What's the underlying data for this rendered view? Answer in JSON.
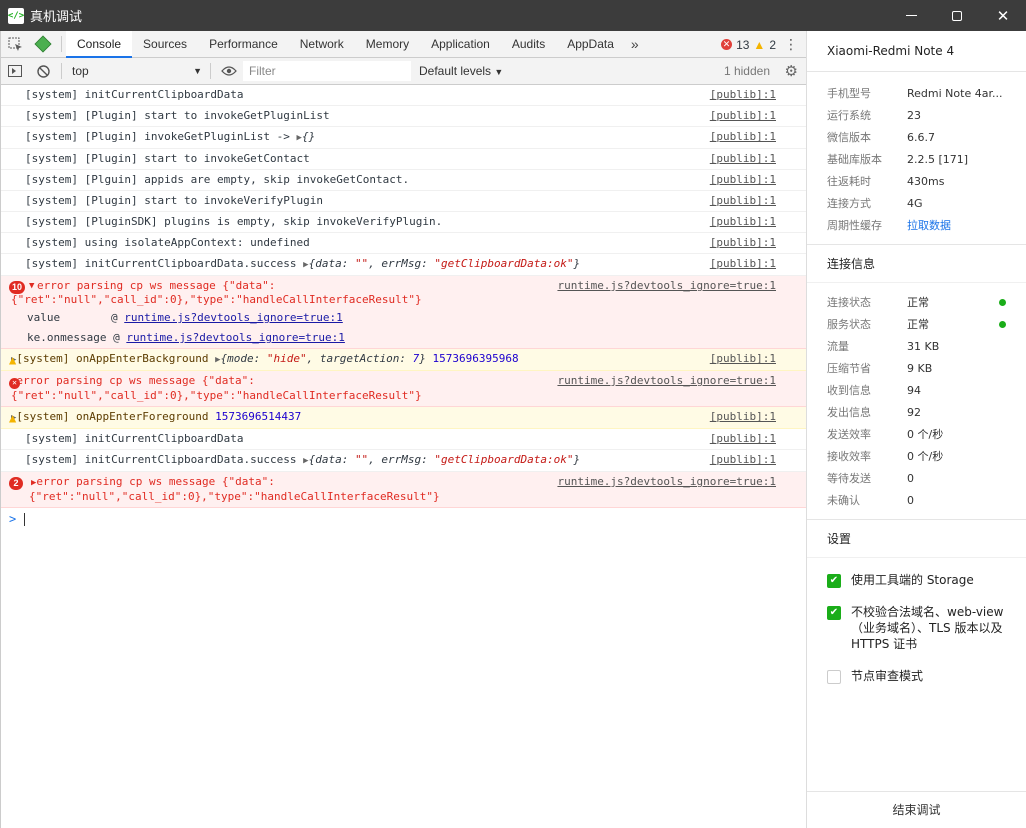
{
  "window": {
    "title": "真机调试",
    "app_icon": "</>"
  },
  "tabs": [
    "Console",
    "Sources",
    "Performance",
    "Network",
    "Memory",
    "Application",
    "Audits",
    "AppData"
  ],
  "counts": {
    "errors": "13",
    "warnings": "2"
  },
  "filterbar": {
    "context": "top",
    "filter_placeholder": "Filter",
    "levels": "Default levels",
    "hidden": "1 hidden"
  },
  "console": {
    "r1": "[system] initCurrentClipboardData",
    "r2": "[system] [Plugin] start to invokeGetPluginList",
    "r3": "[system] [Plugin] invokeGetPluginList ->",
    "r3_obj": "{}",
    "r4": "[system] [Plugin] start to invokeGetContact",
    "r5": "[system] [Plguin] appids are empty, skip invokeGetContact.",
    "r6": "[system] [Plugin] start to invokeVerifyPlugin",
    "r7": "[system] [PluginSDK] plugins is empty, skip invokeVerifyPlugin.",
    "r8": "[system] using isolateAppContext: undefined",
    "r9": "[system] initCurrentClipboardData.success",
    "r9_obj_a": "{data: ",
    "r9_obj_b": "\"\"",
    "r9_obj_c": ", errMsg: ",
    "r9_obj_d": "\"getClipboardData:ok\"",
    "r9_obj_e": "}",
    "e1_badge": "10",
    "e1_line1": "error parsing cp ws message {\"data\":",
    "e1_line2": "{\"ret\":\"null\",\"call_id\":0},\"type\":\"handleCallInterfaceResult\"}",
    "e1_stack1_fn": "value",
    "e1_stack1_at": "@",
    "e1_stack2_fn": "ke.onmessage",
    "e1_stack2_at": "@",
    "runtime_link": "runtime.js?devtools_ignore=true:1",
    "w1": "[system] onAppEnterBackground",
    "w1_obj_a": "{mode: ",
    "w1_obj_b": "\"hide\"",
    "w1_obj_c": ", targetAction: ",
    "w1_obj_d": "7",
    "w1_obj_e": "}",
    "w1_num": "1573696395968",
    "e2_line1": "error parsing cp ws message {\"data\":",
    "e2_line2": "{\"ret\":\"null\",\"call_id\":0},\"type\":\"handleCallInterfaceResult\"}",
    "w2": "[system] onAppEnterForeground",
    "w2_num": "1573696514437",
    "r10": "[system] initCurrentClipboardData",
    "r11": "[system] initCurrentClipboardData.success",
    "e3_badge": "2",
    "e3_line1": "error parsing cp ws message {\"data\":",
    "e3_line2": "{\"ret\":\"null\",\"call_id\":0},\"type\":\"handleCallInterfaceResult\"}",
    "publib": "[publib]:1",
    "prompt": ">"
  },
  "device": {
    "name": "Xiaomi-Redmi Note 4",
    "info": [
      {
        "k": "手机型号",
        "v": "Redmi Note 4ar..."
      },
      {
        "k": "运行系统",
        "v": "23"
      },
      {
        "k": "微信版本",
        "v": "6.6.7"
      },
      {
        "k": "基础库版本",
        "v": "2.2.5 [171]"
      },
      {
        "k": "往返耗时",
        "v": "430ms"
      },
      {
        "k": "连接方式",
        "v": "4G"
      },
      {
        "k": "周期性缓存",
        "v": "拉取数据"
      }
    ],
    "conn_title": "连接信息",
    "conn": [
      {
        "k": "连接状态",
        "v": "正常"
      },
      {
        "k": "服务状态",
        "v": "正常"
      },
      {
        "k": "流量",
        "v": "31 KB"
      },
      {
        "k": "压缩节省",
        "v": "9 KB"
      },
      {
        "k": "收到信息",
        "v": "94"
      },
      {
        "k": "发出信息",
        "v": "92"
      },
      {
        "k": "发送效率",
        "v": "0 个/秒"
      },
      {
        "k": "接收效率",
        "v": "0 个/秒"
      },
      {
        "k": "等待发送",
        "v": "0"
      },
      {
        "k": "未确认",
        "v": "0"
      }
    ],
    "settings_title": "设置",
    "settings": [
      {
        "label": "使用工具端的 Storage",
        "checked": true
      },
      {
        "label": "不校验合法域名、web-view（业务域名）、TLS 版本以及 HTTPS 证书",
        "checked": true
      },
      {
        "label": "节点审查模式",
        "checked": false
      }
    ],
    "stop": "结束调试"
  }
}
